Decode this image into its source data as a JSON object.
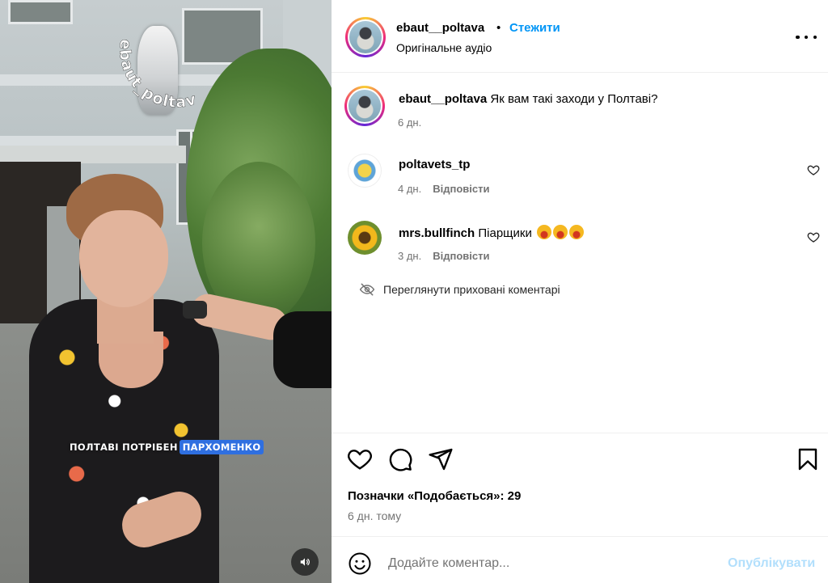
{
  "video": {
    "watermark": "ebaut_poltava",
    "caption_plain": "ПОЛТАВІ ПОТРІБЕН",
    "caption_highlight": "ПАРХОМЕНКО",
    "mute_icon": "speaker-icon"
  },
  "header": {
    "username": "ebaut__poltava",
    "separator": "•",
    "follow_label": "Стежити",
    "audio": "Оригінальне аудіо",
    "more_icon": "more-horizontal-icon"
  },
  "comments": [
    {
      "username": "ebaut__poltava",
      "text": "Як вам такі заходи у Полтаві?",
      "time": "6 дн."
    },
    {
      "username": "poltavets_tp",
      "text": "",
      "time": "4 дн.",
      "reply": "Відповісти"
    },
    {
      "username": "mrs.bullfinch",
      "text": "Піарщики",
      "emojis": 3,
      "time": "3 дн.",
      "reply": "Відповісти"
    }
  ],
  "hidden_comments": "Переглянути приховані коментарі",
  "actions": {
    "likes": "Позначки «Подобається»: 29",
    "posted": "6 дн. тому"
  },
  "add_comment": {
    "placeholder": "Додайте коментар...",
    "post_label": "Опублікувати"
  },
  "colors": {
    "accent": "#0095f6",
    "post_disabled": "#b2dffc",
    "caption_highlight": "#2f6fe0",
    "muted_text": "#737373"
  }
}
